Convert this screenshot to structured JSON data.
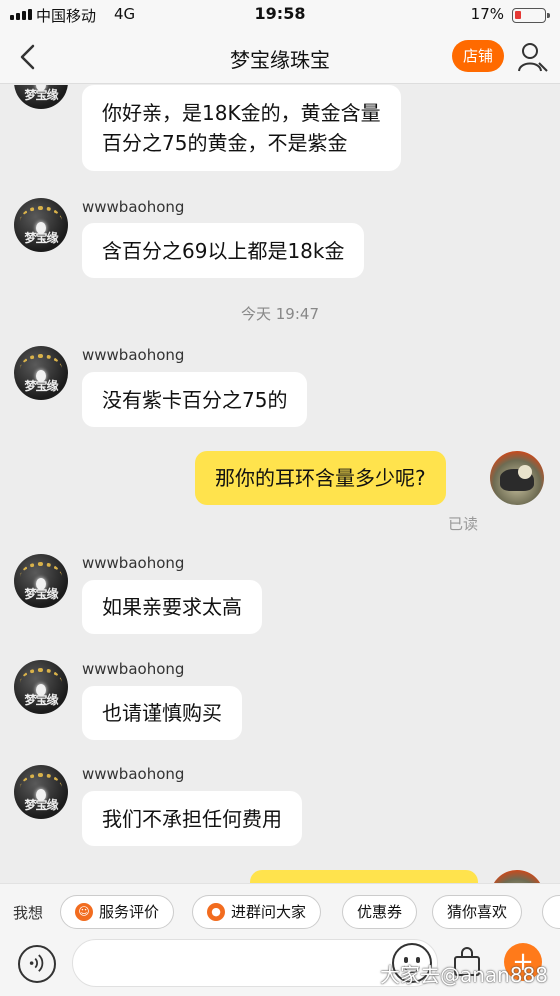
{
  "status_bar": {
    "carrier": "中国移动",
    "network": "4G",
    "time": "19:58",
    "battery": "17%"
  },
  "nav": {
    "title": "梦宝缘珠宝",
    "shop_button": "店铺"
  },
  "avatar_text": "梦宝缘",
  "chat": {
    "msg0": {
      "text_line1": "你好亲，是18K金的，黄金含量",
      "text_line2": "百分之75的黄金，不是紫金"
    },
    "msg1": {
      "sender": "wwwbaohong",
      "text": "含百分之69以上都是18k金"
    },
    "timestamp": "今天 19:47",
    "msg2": {
      "sender": "wwwbaohong",
      "text": "没有紫卡百分之75的"
    },
    "msg3": {
      "text": "那你的耳环含量多少呢?",
      "status": "已读"
    },
    "msg4": {
      "sender": "wwwbaohong",
      "text": "如果亲要求太高"
    },
    "msg5": {
      "sender": "wwwbaohong",
      "text": "也请谨慎购买"
    },
    "msg6": {
      "sender": "wwwbaohong",
      "text": "我们不承担任何费用"
    }
  },
  "quick": {
    "label": "我想",
    "chips": [
      "服务评价",
      "进群问大家",
      "优惠券",
      "猜你喜欢"
    ]
  },
  "watermark": "大家去@anan888",
  "colors": {
    "accent": "#ff6a00",
    "my_bubble": "#ffe34d"
  }
}
